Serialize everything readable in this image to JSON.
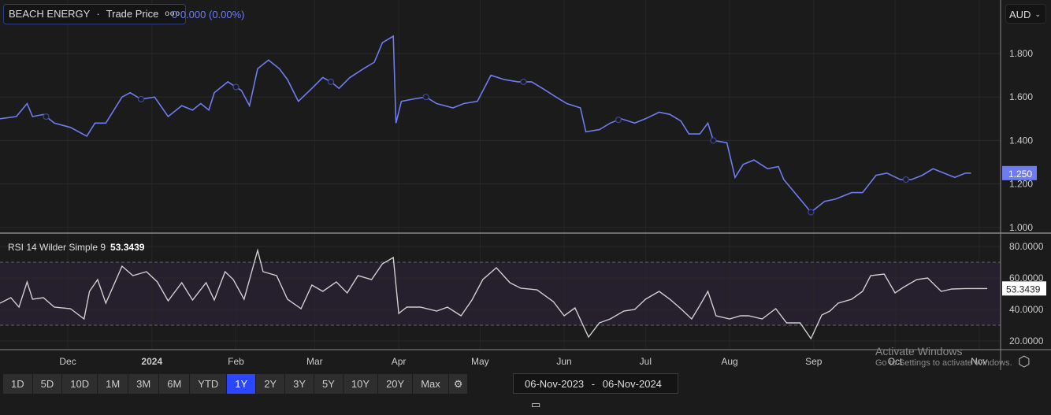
{
  "legend": {
    "name": "BEACH ENERGY",
    "sep": "·",
    "series": "Trade Price",
    "menu": "ooo",
    "change": "0  0.000 (0.00%)"
  },
  "rsi_label": {
    "name": "RSI 14 Wilder Simple 9",
    "value": "53.3439"
  },
  "currency": "AUD",
  "ranges": [
    "1D",
    "5D",
    "10D",
    "1M",
    "3M",
    "6M",
    "YTD",
    "1Y",
    "2Y",
    "3Y",
    "5Y",
    "10Y",
    "20Y",
    "Max"
  ],
  "active_range": "1Y",
  "date_from": "06-Nov-2023",
  "date_sep": "-",
  "date_to": "06-Nov-2024",
  "watermark": {
    "title": "Activate Windows",
    "sub": "Go to Settings to activate Windows."
  },
  "colors": {
    "price": "#6f7cf0",
    "rsi": "#cfcfcf",
    "bg": "#1b1b1b",
    "band": "#251f2e"
  },
  "chart_data": [
    {
      "type": "line",
      "title": "BEACH ENERGY Trade Price",
      "x_unit": "days since 06-Nov-2023",
      "ylim": [
        0.95,
        1.95
      ],
      "yticks": [
        "1.000",
        "1.200",
        "1.400",
        "1.600",
        "1.800"
      ],
      "last_label": "1.250",
      "xticks": [
        {
          "label": "Dec",
          "day": 25
        },
        {
          "label": "2024",
          "day": 56
        },
        {
          "label": "Feb",
          "day": 87
        },
        {
          "label": "Mar",
          "day": 116
        },
        {
          "label": "Apr",
          "day": 147
        },
        {
          "label": "May",
          "day": 177
        },
        {
          "label": "Jun",
          "day": 208
        },
        {
          "label": "Jul",
          "day": 238
        },
        {
          "label": "Aug",
          "day": 269
        },
        {
          "label": "Sep",
          "day": 300
        },
        {
          "label": "Oct",
          "day": 330
        },
        {
          "label": "Nov",
          "day": 361
        }
      ],
      "markers": [
        17,
        52,
        87,
        122,
        157,
        193,
        228,
        263,
        299,
        334
      ],
      "days": [
        0,
        6,
        10,
        12,
        16,
        20,
        26,
        32,
        35,
        39,
        45,
        48,
        52,
        57,
        62,
        67,
        71,
        74,
        77,
        79,
        84,
        89,
        92,
        95,
        99,
        103,
        106,
        110,
        115,
        119,
        122,
        125,
        129,
        134,
        138,
        141,
        145,
        146,
        148,
        152,
        157,
        161,
        167,
        171,
        176,
        181,
        186,
        191,
        196,
        200,
        205,
        209,
        214,
        216,
        221,
        225,
        229,
        234,
        238,
        243,
        247,
        251,
        254,
        258,
        261,
        263,
        268,
        271,
        274,
        278,
        283,
        287,
        289,
        293,
        299,
        304,
        308,
        314,
        318,
        323,
        327,
        332,
        336,
        340,
        344,
        348,
        352,
        356,
        358
      ],
      "values": [
        1.5,
        1.51,
        1.57,
        1.51,
        1.52,
        1.48,
        1.46,
        1.42,
        1.48,
        1.48,
        1.6,
        1.62,
        1.59,
        1.6,
        1.51,
        1.56,
        1.54,
        1.57,
        1.54,
        1.62,
        1.67,
        1.63,
        1.56,
        1.73,
        1.77,
        1.73,
        1.68,
        1.58,
        1.64,
        1.69,
        1.67,
        1.64,
        1.69,
        1.73,
        1.76,
        1.85,
        1.88,
        1.48,
        1.58,
        1.59,
        1.6,
        1.57,
        1.55,
        1.57,
        1.58,
        1.7,
        1.68,
        1.67,
        1.67,
        1.64,
        1.6,
        1.57,
        1.55,
        1.44,
        1.45,
        1.48,
        1.5,
        1.48,
        1.5,
        1.53,
        1.52,
        1.49,
        1.43,
        1.43,
        1.48,
        1.4,
        1.39,
        1.23,
        1.29,
        1.31,
        1.27,
        1.28,
        1.22,
        1.16,
        1.07,
        1.12,
        1.13,
        1.16,
        1.16,
        1.24,
        1.25,
        1.22,
        1.22,
        1.24,
        1.27,
        1.25,
        1.23,
        1.25,
        1.25
      ]
    },
    {
      "type": "line",
      "title": "RSI 14 Wilder Simple 9",
      "ylim": [
        12,
        86
      ],
      "band": [
        30,
        70
      ],
      "yticks": [
        "20.0000",
        "40.0000",
        "60.0000",
        "80.0000"
      ],
      "last_label": "53.3439",
      "days": [
        0,
        4,
        7,
        10,
        12,
        16,
        20,
        26,
        31,
        33,
        36,
        39,
        45,
        49,
        54,
        58,
        62,
        67,
        71,
        76,
        79,
        83,
        86,
        90,
        95,
        97,
        102,
        106,
        111,
        115,
        119,
        124,
        128,
        132,
        137,
        141,
        145,
        147,
        150,
        155,
        161,
        165,
        170,
        174,
        178,
        183,
        188,
        192,
        198,
        204,
        208,
        212,
        217,
        221,
        225,
        230,
        234,
        238,
        243,
        247,
        251,
        255,
        258,
        261,
        264,
        269,
        273,
        276,
        281,
        286,
        290,
        295,
        299,
        303,
        306,
        309,
        314,
        318,
        321,
        326,
        330,
        333,
        338,
        342,
        347,
        351,
        356,
        360,
        364
      ],
      "values": [
        44,
        47.5,
        41.5,
        57.5,
        46.5,
        47.5,
        41.5,
        40.5,
        34,
        51.5,
        59,
        44,
        67.5,
        61.5,
        64,
        57.5,
        45.5,
        57,
        46,
        57,
        46,
        64,
        59,
        46.5,
        77.5,
        64,
        61.5,
        46.5,
        40.5,
        55.5,
        51.5,
        57.5,
        50.5,
        61.5,
        59,
        69,
        73,
        37.5,
        41.5,
        41.5,
        39,
        41.5,
        36,
        46,
        59,
        66.5,
        57,
        53.5,
        52.5,
        45,
        36,
        41,
        22.5,
        31.5,
        34,
        39,
        40,
        46.5,
        51.5,
        46.5,
        40.5,
        34,
        42.5,
        51.5,
        36,
        34,
        36,
        36,
        34,
        40.5,
        31.5,
        31.5,
        21.5,
        36.5,
        39,
        44,
        46.5,
        51.5,
        61.5,
        62.5,
        50.5,
        54,
        59,
        60,
        51.5,
        53,
        53.3,
        53.3,
        53.3
      ]
    }
  ]
}
